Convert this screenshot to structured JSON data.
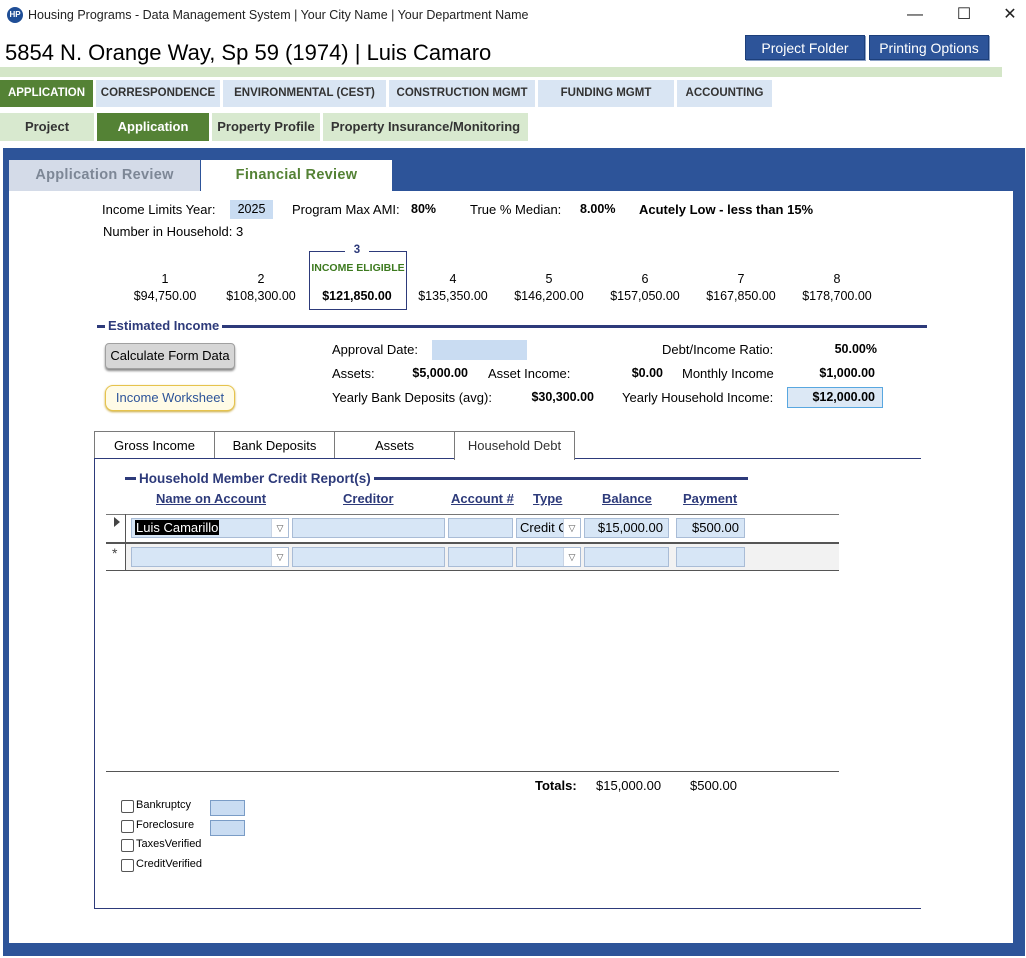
{
  "window": {
    "title": "Housing Programs - Data Management System | Your City Name | Your Department Name",
    "minimize": "—",
    "maximize": "☐",
    "close": "✕"
  },
  "record": {
    "title": "5854 N. Orange Way, Sp 59 (1974) | Luis Camaro"
  },
  "header_buttons": {
    "project_folder": "Project Folder",
    "printing_options": "Printing Options"
  },
  "main_tabs": [
    "APPLICATION",
    "CORRESPONDENCE",
    "ENVIRONMENTAL (CEST)",
    "CONSTRUCTION MGMT",
    "FUNDING MGMT",
    "ACCOUNTING"
  ],
  "sub_tabs": [
    "Project",
    "Application",
    "Property Profile",
    "Property Insurance/Monitoring"
  ],
  "review_tabs": [
    "Application Review",
    "Financial Review"
  ],
  "financial": {
    "income_limits_year_label": "Income Limits Year:",
    "income_limits_year": "2025",
    "program_max_ami_label": "Program Max AMI:",
    "program_max_ami": "80%",
    "true_median_label": "True % Median:",
    "true_median": "8.00%",
    "income_category": "Acutely Low - less than 15%",
    "household_label": "Number in Household: 3"
  },
  "income_limits": {
    "household_sizes": [
      "1",
      "2",
      "3",
      "4",
      "5",
      "6",
      "7",
      "8"
    ],
    "amounts": [
      "$94,750.00",
      "$108,300.00",
      "$121,850.00",
      "$135,350.00",
      "$146,200.00",
      "$157,050.00",
      "$167,850.00",
      "$178,700.00"
    ],
    "eligible_label": "INCOME ELIGIBLE"
  },
  "estimated_income": {
    "section_title": "Estimated Income",
    "calculate_button": "Calculate Form Data",
    "worksheet_button": "Income Worksheet",
    "approval_date_label": "Approval Date:",
    "approval_date": "",
    "assets_label": "Assets:",
    "assets": "$5,000.00",
    "asset_income_label": "Asset Income:",
    "asset_income": "$0.00",
    "yearly_bank_label": "Yearly Bank Deposits (avg):",
    "yearly_bank": "$30,300.00",
    "debt_ratio_label": "Debt/Income Ratio:",
    "debt_ratio": "50.00%",
    "monthly_income_label": "Monthly Income",
    "monthly_income": "$1,000.00",
    "yearly_household_label": "Yearly Household Income:",
    "yearly_household": "$12,000.00"
  },
  "detail_tabs": [
    "Gross Income",
    "Bank Deposits",
    "Assets",
    "Household Debt"
  ],
  "credit_report": {
    "section_title": "Household Member Credit Report(s)",
    "columns": [
      "Name on Account",
      "Creditor",
      "Account #",
      "Type",
      "Balance",
      "Payment"
    ],
    "rows": [
      {
        "name": "Luis Camarillo",
        "creditor": "",
        "account": "",
        "type": "Credit C",
        "balance": "$15,000.00",
        "payment": "$500.00"
      }
    ],
    "new_row_marker": "*",
    "totals_label": "Totals:",
    "total_balance": "$15,000.00",
    "total_payment": "$500.00"
  },
  "checkboxes": [
    "Bankruptcy",
    "Foreclosure",
    "TaxesVerified",
    "CreditVerified"
  ],
  "colors": {
    "accent_blue": "#2d5499",
    "accent_green": "#548235",
    "field_blue": "#c9dcf2"
  }
}
